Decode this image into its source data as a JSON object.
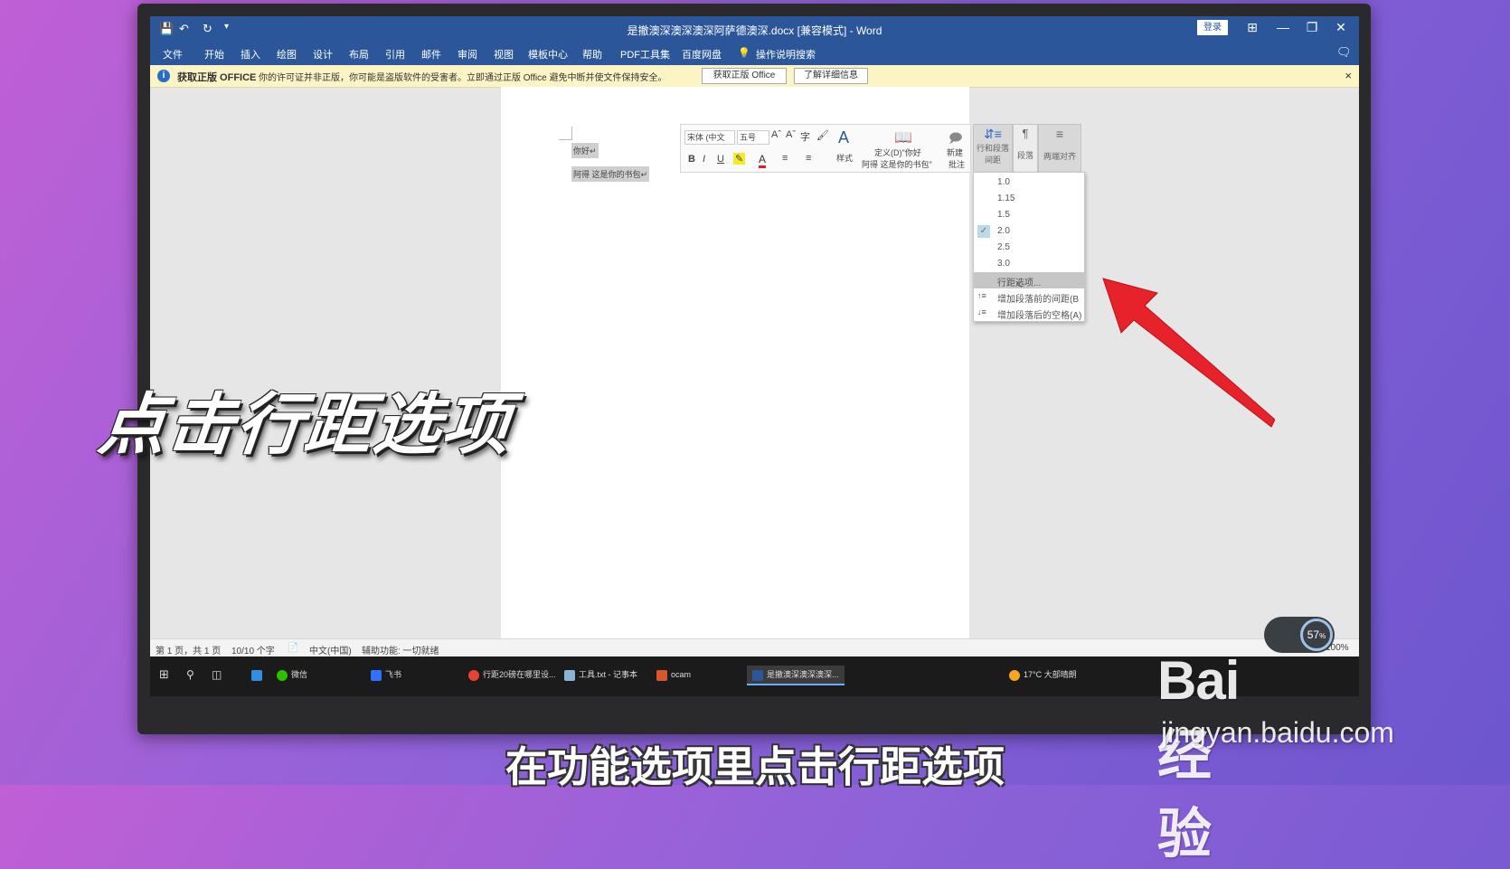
{
  "word": {
    "title": "是撤澳深澳深澳深阿萨德澳深.docx [兼容模式] - Word",
    "login": "登录",
    "window_controls": {
      "minimize": "—",
      "restore": "❐",
      "close": "✕",
      "ribbon_display": "⊞"
    },
    "quick_access": {
      "save_icon": "save-icon",
      "undo_icon": "undo-icon",
      "redo_icon": "redo-icon"
    },
    "menu": [
      "文件",
      "开始",
      "插入",
      "绘图",
      "设计",
      "布局",
      "引用",
      "邮件",
      "审阅",
      "视图",
      "模板中心",
      "帮助",
      "PDF工具集",
      "百度网盘",
      "操作说明搜索"
    ],
    "infobar": {
      "heading": "获取正版 OFFICE",
      "message": "你的许可证并非正版，你可能是盗版软件的受害者。立即通过正版 Office 避免中断并使文件保持安全。",
      "btn_get": "获取正版 Office",
      "btn_learn": "了解详细信息",
      "close": "×"
    },
    "document": {
      "line1": "你好↵",
      "line2": "阿得  这是你的书包↵"
    },
    "minibar": {
      "font": "宋体 (中文",
      "size": "五号",
      "bold": "B",
      "italic": "I",
      "underline": "U",
      "font_color": "A",
      "styles": "样式",
      "define": "定义(D)\"你好",
      "define2": "阿得 这是你的书包\"",
      "new_comment_1": "新建",
      "new_comment_2": "批注",
      "line_spacing_1": "行和段落",
      "line_spacing_2": "间距",
      "paragraph": "段落",
      "justify": "两端对齐"
    },
    "line_spacing_menu": {
      "options": [
        "1.0",
        "1.15",
        "1.5",
        "2.0",
        "2.5",
        "3.0"
      ],
      "checked": "2.0",
      "line_options": "行距选项...",
      "add_before": "增加段落前的间距(B",
      "add_after": "增加段落后的空格(A)"
    },
    "statusbar": {
      "page": "第 1 页，共 1 页",
      "words": "10/10 个字",
      "lang": "中文(中国)",
      "accessibility": "辅助功能: 一切就绪",
      "zoom": "100%"
    }
  },
  "taskbar": {
    "items": [
      "微信",
      "飞书",
      "行距20磅在哪里设...",
      "工具.txt - 记事本",
      "ocam",
      "是撤澳深澳深澳深..."
    ],
    "weather": "17°C  大部晴朗",
    "cpu": "57",
    "cpu_unit": "%"
  },
  "overlay": {
    "headline": "点击行距选项",
    "subtitle": "在功能选项里点击行距选项",
    "wm_logo": "Bai 经验",
    "wm_url": "jingyan.baidu.com"
  },
  "colors": {
    "word_blue": "#2b579a",
    "arrow_red": "#e8222a"
  }
}
